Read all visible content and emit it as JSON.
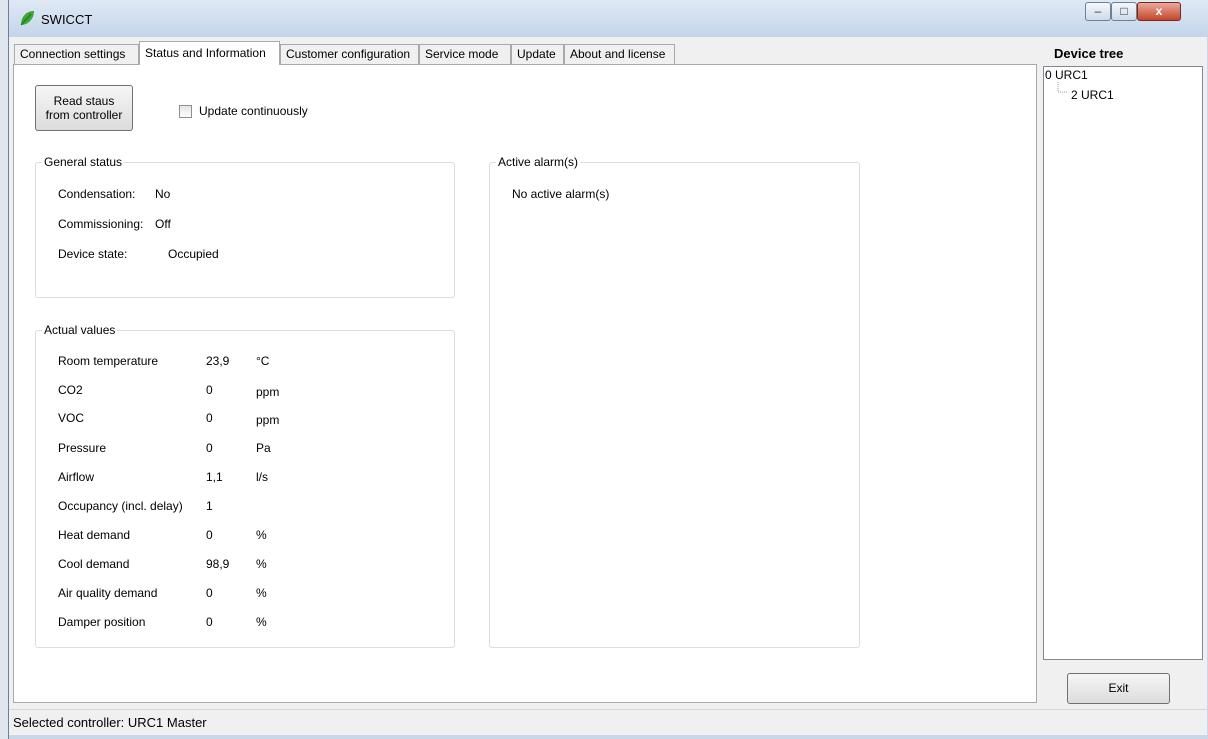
{
  "window": {
    "title": "SWICCT",
    "minimize_glyph": "–",
    "maximize_glyph": "□",
    "close_glyph": "x"
  },
  "tabs": [
    {
      "label": "Connection settings"
    },
    {
      "label": "Status and Information"
    },
    {
      "label": "Customer configuration"
    },
    {
      "label": "Service mode"
    },
    {
      "label": "Update"
    },
    {
      "label": "About and license"
    }
  ],
  "toolbar": {
    "read_button": "Read staus\nfrom controller",
    "update_continuously": "Update continuously",
    "update_checked": false
  },
  "general_status": {
    "title": "General status",
    "rows": [
      {
        "label": "Condensation:",
        "value": "No"
      },
      {
        "label": "Commissioning:",
        "value": "Off"
      },
      {
        "label": "Device state:",
        "value": "Occupied"
      }
    ]
  },
  "active_alarms": {
    "title": "Active alarm(s)",
    "message": "No active alarm(s)"
  },
  "actual_values": {
    "title": "Actual values",
    "rows": [
      {
        "label": "Room temperature",
        "value": "23,9",
        "unit": "°C"
      },
      {
        "label": "CO2",
        "value": "0",
        "unit": "ppm"
      },
      {
        "label": "VOC",
        "value": "0",
        "unit": "ppm"
      },
      {
        "label": "Pressure",
        "value": "0",
        "unit": "Pa"
      },
      {
        "label": "Airflow",
        "value": "1,1",
        "unit": "l/s"
      },
      {
        "label": "Occupancy (incl. delay)",
        "value": "1",
        "unit": ""
      },
      {
        "label": "Heat demand",
        "value": "0",
        "unit": "%"
      },
      {
        "label": "Cool demand",
        "value": "98,9",
        "unit": "%"
      },
      {
        "label": "Air quality demand",
        "value": "0",
        "unit": "%"
      },
      {
        "label": "Damper position",
        "value": "0",
        "unit": "%"
      }
    ]
  },
  "device_tree": {
    "heading": "Device tree",
    "nodes": [
      {
        "label": "0 URC1"
      },
      {
        "label": "2 URC1"
      }
    ]
  },
  "exit_button": "Exit",
  "status_bar": {
    "text": "Selected controller: URC1 Master"
  }
}
